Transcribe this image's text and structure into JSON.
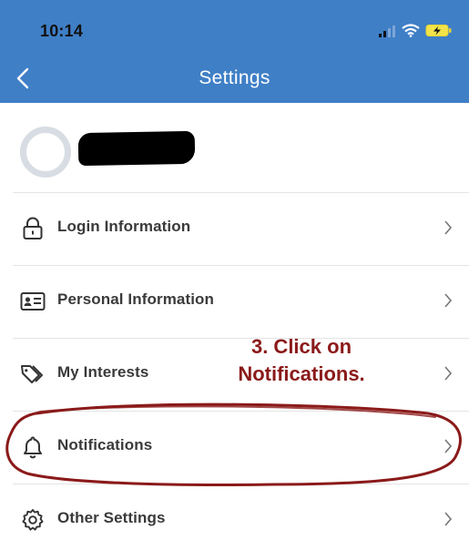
{
  "status_bar": {
    "time": "10:14"
  },
  "nav": {
    "title": "Settings"
  },
  "menu": {
    "items": [
      {
        "label": "Login Information",
        "icon": "lock-icon"
      },
      {
        "label": "Personal Information",
        "icon": "id-card-icon"
      },
      {
        "label": "My Interests",
        "icon": "tags-icon"
      },
      {
        "label": "Notifications",
        "icon": "bell-icon"
      },
      {
        "label": "Other Settings",
        "icon": "gear-icon"
      }
    ]
  },
  "annotation": {
    "line1": "3.  Click on",
    "line2": "Notifications."
  },
  "colors": {
    "header": "#3f7fc6",
    "annotation": "#8b1a1a",
    "label": "#3a3a3a"
  }
}
